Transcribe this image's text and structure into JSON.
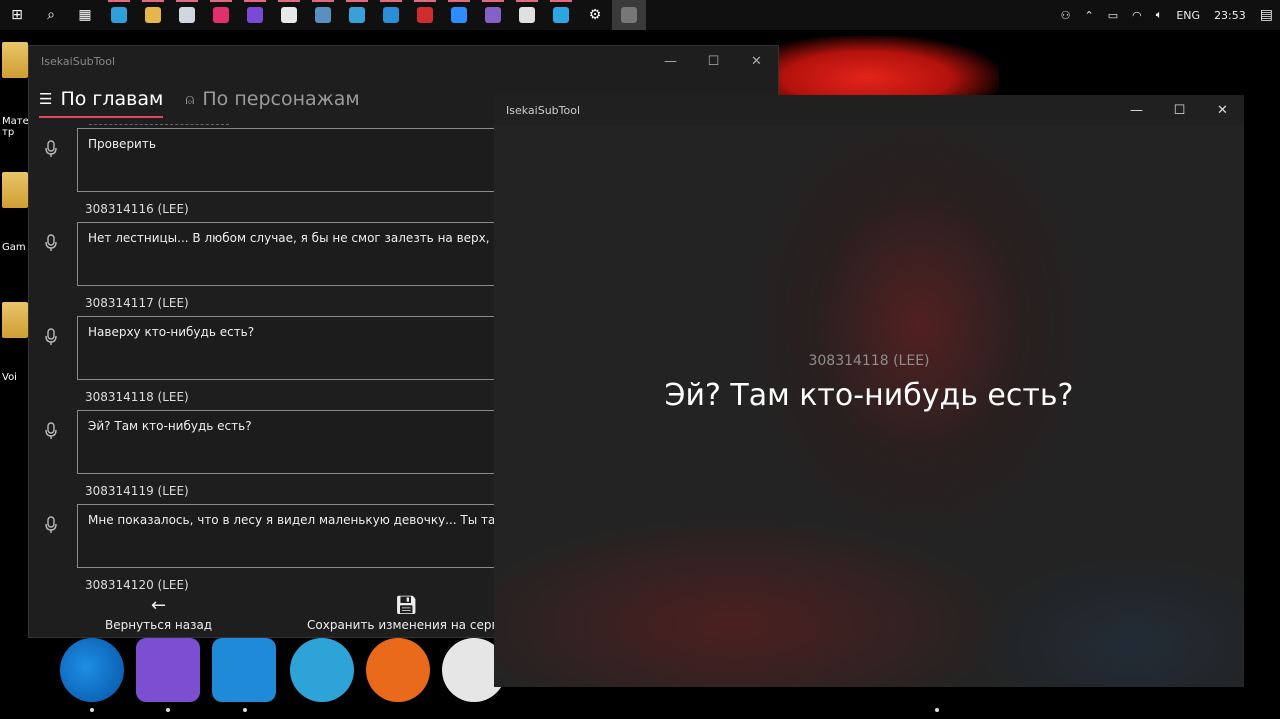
{
  "taskbar": {
    "icons": [
      {
        "name": "windows-start-icon",
        "glyph": "⊞",
        "color": "#ffffff"
      },
      {
        "name": "search-icon",
        "glyph": "⌕",
        "color": "#ffffff"
      },
      {
        "name": "task-view-icon",
        "glyph": "▦",
        "color": "#ffffff"
      },
      {
        "name": "app-icon",
        "color": "#2e9fd8"
      },
      {
        "name": "file-explorer-icon",
        "color": "#e7b64a"
      },
      {
        "name": "store-icon",
        "color": "#cfd6df"
      },
      {
        "name": "app-icon",
        "color": "#e1306c"
      },
      {
        "name": "app-icon",
        "color": "#7a4ad6"
      },
      {
        "name": "mail-icon",
        "color": "#e8e8e8"
      },
      {
        "name": "app-icon",
        "color": "#5a8fc0"
      },
      {
        "name": "app-icon",
        "color": "#3aa0d8"
      },
      {
        "name": "vscode-icon",
        "color": "#2a8fd6"
      },
      {
        "name": "animate-icon",
        "color": "#d22d2d"
      },
      {
        "name": "zoom-icon",
        "color": "#2d8cff"
      },
      {
        "name": "visual-studio-icon",
        "color": "#8661c5"
      },
      {
        "name": "calculator-icon",
        "color": "#e0e0e0"
      },
      {
        "name": "telegram-icon",
        "color": "#2ca5e0"
      },
      {
        "name": "settings-icon",
        "glyph": "⚙",
        "color": "#ffffff"
      },
      {
        "name": "isekaisubtool-taskbar-icon",
        "color": "#777777"
      }
    ],
    "tray": {
      "lang": "ENG",
      "time": "23:53"
    }
  },
  "left_window": {
    "title": "IsekaiSubTool",
    "tabs": [
      {
        "label": "По главам",
        "active": true
      },
      {
        "label": "По персонажам",
        "active": false
      }
    ],
    "rows": [
      {
        "text": "Проверить",
        "id": "308314116 (LEE)"
      },
      {
        "text": "Нет лестницы... В любом случае, я бы не смог залезть на верх, нога",
        "id": "308314117 (LEE)"
      },
      {
        "text": "Наверху кто-нибудь есть?",
        "id": "308314118 (LEE)"
      },
      {
        "text": "Эй? Там кто-нибудь есть?",
        "id": "308314119 (LEE)"
      },
      {
        "text": "Мне показалось, что в лесу я видел маленькую девочку... Ты там? Я",
        "id": "308314120 (LEE)"
      }
    ],
    "bottom": {
      "back_label": "Вернуться назад",
      "save_label": "Сохранить изменения на серве"
    }
  },
  "right_window": {
    "title": "IsekaiSubTool",
    "subtitle_id": "308314118 (LEE)",
    "subtitle_text": "Эй? Там кто-нибудь есть?"
  },
  "desktop": {
    "labels": [
      "Мате тр",
      "Gam",
      "Voi"
    ]
  },
  "colors": {
    "accent": "#e8455a",
    "window_bg": "#1e1e1e",
    "subtitle_bg": "#232323"
  }
}
